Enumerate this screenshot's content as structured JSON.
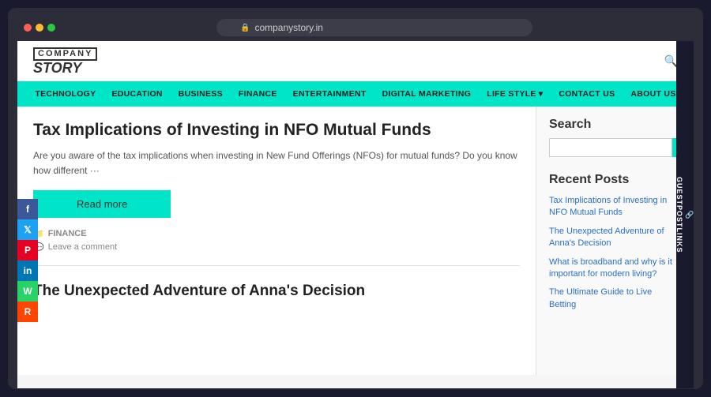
{
  "browser": {
    "url": "companystory.in",
    "lock_icon": "🔒"
  },
  "header": {
    "logo_company": "COMPANY",
    "logo_story": "STORY",
    "nav_items": [
      {
        "label": "TECHNOLOGY",
        "has_dropdown": false
      },
      {
        "label": "EDUCATION",
        "has_dropdown": false
      },
      {
        "label": "BUSINESS",
        "has_dropdown": false
      },
      {
        "label": "FINANCE",
        "has_dropdown": false
      },
      {
        "label": "Entertainment",
        "has_dropdown": false
      },
      {
        "label": "DIGITAL MARKETING",
        "has_dropdown": false
      },
      {
        "label": "LIFE STYLE",
        "has_dropdown": true
      },
      {
        "label": "Contact Us",
        "has_dropdown": false
      },
      {
        "label": "About Us",
        "has_dropdown": false
      }
    ]
  },
  "main": {
    "article1": {
      "title": "Tax Implications of Investing in NFO Mutual Funds",
      "excerpt": "Are you aware of the tax implications when investing in New Fund Offerings (NFOs) for mutual funds? Do you know how different ···",
      "read_more": "Read more",
      "category": "FINANCE",
      "comment": "Leave a comment"
    },
    "article2": {
      "title": "The Unexpected Adventure of Anna's Decision"
    }
  },
  "sidebar": {
    "search_label": "Search",
    "search_placeholder": "",
    "search_btn": "Search",
    "recent_posts_title": "Recent Posts",
    "recent_posts": [
      "Tax Implications of Investing in NFO Mutual Funds",
      "The Unexpected Adventure of Anna's Decision",
      "What is broadband and why is it important for modern living?",
      "The Ultimate Guide to Live Betting"
    ]
  },
  "social": [
    {
      "label": "f",
      "class": "social-fb",
      "name": "facebook"
    },
    {
      "label": "t",
      "class": "social-tw",
      "name": "twitter"
    },
    {
      "label": "p",
      "class": "social-pin",
      "name": "pinterest"
    },
    {
      "label": "in",
      "class": "social-li",
      "name": "linkedin"
    },
    {
      "label": "w",
      "class": "social-wa",
      "name": "whatsapp"
    },
    {
      "label": "r",
      "class": "social-reddit",
      "name": "reddit"
    }
  ],
  "guestpost": {
    "icon": "🔗",
    "text": "GUESTPOSTLINKS"
  }
}
